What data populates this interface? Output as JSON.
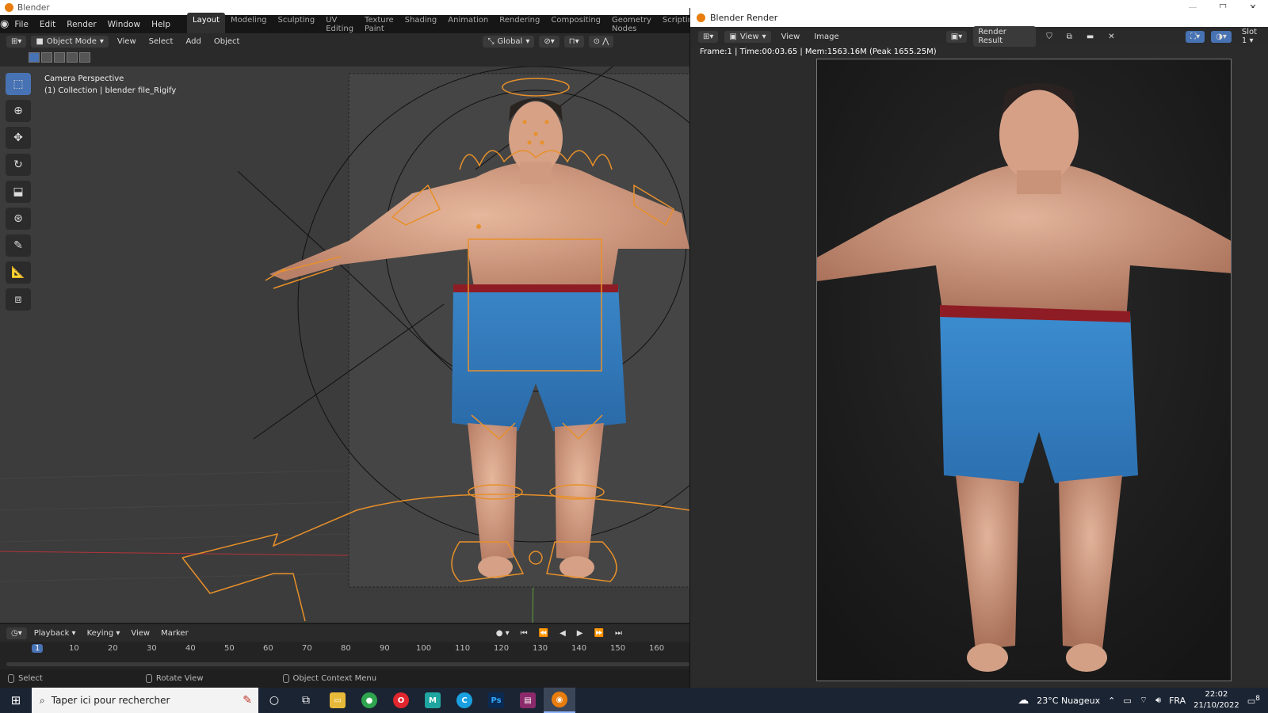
{
  "window": {
    "title": "Blender"
  },
  "menu": [
    "File",
    "Edit",
    "Render",
    "Window",
    "Help"
  ],
  "workspaces": [
    {
      "label": "Layout",
      "active": true
    },
    {
      "label": "Modeling",
      "active": false
    },
    {
      "label": "Sculpting",
      "active": false
    },
    {
      "label": "UV Editing",
      "active": false
    },
    {
      "label": "Texture Paint",
      "active": false
    },
    {
      "label": "Shading",
      "active": false
    },
    {
      "label": "Animation",
      "active": false
    },
    {
      "label": "Rendering",
      "active": false
    },
    {
      "label": "Compositing",
      "active": false
    },
    {
      "label": "Geometry Nodes",
      "active": false
    },
    {
      "label": "Scripting",
      "active": false
    }
  ],
  "viewport_header": {
    "mode": "Object Mode",
    "menus": [
      "View",
      "Select",
      "Add",
      "Object"
    ],
    "orientation": "Global"
  },
  "viewport": {
    "line1": "Camera Perspective",
    "line2": "(1) Collection | blender file_Rigify"
  },
  "timeline": {
    "menus": [
      "Playback",
      "Keying",
      "View",
      "Marker"
    ],
    "current_frame": "1",
    "ticks": [
      "10",
      "20",
      "30",
      "40",
      "50",
      "60",
      "70",
      "80",
      "90",
      "100",
      "110",
      "120",
      "130",
      "140",
      "150",
      "160"
    ]
  },
  "statusbar": {
    "select": "Select",
    "rotate": "Rotate View",
    "context": "Object Context Menu"
  },
  "render_window": {
    "title": "Blender Render",
    "view_menu": "View",
    "menus": [
      "View",
      "Image"
    ],
    "image_name": "Render Result",
    "slot": "Slot 1",
    "info": "Frame:1 | Time:00:03.65 | Mem:1563.16M (Peak 1655.25M)"
  },
  "taskbar": {
    "search_placeholder": "Taper ici pour rechercher",
    "weather": "23°C  Nuageux",
    "lang": "FRA",
    "time": "22:02",
    "date": "21/10/2022",
    "notif_count": "8"
  },
  "colors": {
    "accent": "#4772b3",
    "rig": "#e8902a",
    "brand": "#e87d0d"
  }
}
